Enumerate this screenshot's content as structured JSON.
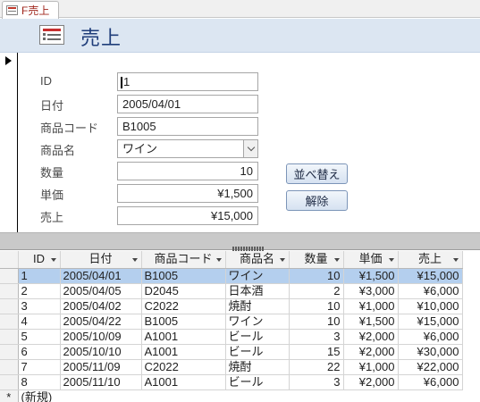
{
  "tab": {
    "label": "F売上"
  },
  "form": {
    "title": "売上",
    "fields": {
      "id": {
        "label": "ID",
        "value": "1"
      },
      "date": {
        "label": "日付",
        "value": "2005/04/01"
      },
      "product_code": {
        "label": "商品コード",
        "value": "B1005"
      },
      "product_name": {
        "label": "商品名",
        "value": "ワイン"
      },
      "quantity": {
        "label": "数量",
        "value": "10"
      },
      "unit_price": {
        "label": "単価",
        "value": "¥1,500"
      },
      "sales": {
        "label": "売上",
        "value": "¥15,000"
      }
    },
    "buttons": {
      "sort": "並べ替え",
      "clear": "解除"
    }
  },
  "datasheet": {
    "columns": [
      "ID",
      "日付",
      "商品コード",
      "商品名",
      "数量",
      "単価",
      "売上"
    ],
    "rows": [
      [
        "1",
        "2005/04/01",
        "B1005",
        "ワイン",
        "10",
        "¥1,500",
        "¥15,000"
      ],
      [
        "2",
        "2005/04/05",
        "D2045",
        "日本酒",
        "2",
        "¥3,000",
        "¥6,000"
      ],
      [
        "3",
        "2005/04/02",
        "C2022",
        "焼酎",
        "10",
        "¥1,000",
        "¥10,000"
      ],
      [
        "4",
        "2005/04/22",
        "B1005",
        "ワイン",
        "10",
        "¥1,500",
        "¥15,000"
      ],
      [
        "5",
        "2005/10/09",
        "A1001",
        "ビール",
        "3",
        "¥2,000",
        "¥6,000"
      ],
      [
        "6",
        "2005/10/10",
        "A1001",
        "ビール",
        "15",
        "¥2,000",
        "¥30,000"
      ],
      [
        "7",
        "2005/11/09",
        "C2022",
        "焼酎",
        "22",
        "¥1,000",
        "¥22,000"
      ],
      [
        "8",
        "2005/11/10",
        "A1001",
        "ビール",
        "3",
        "¥2,000",
        "¥6,000"
      ]
    ],
    "new_row_marker": "*",
    "new_row_label": "(新規)"
  },
  "colors": {
    "header_bg": "#dce6f2",
    "title": "#1f3d7a",
    "selected_row": "#b4cfee",
    "tab_text": "#a0271d"
  }
}
